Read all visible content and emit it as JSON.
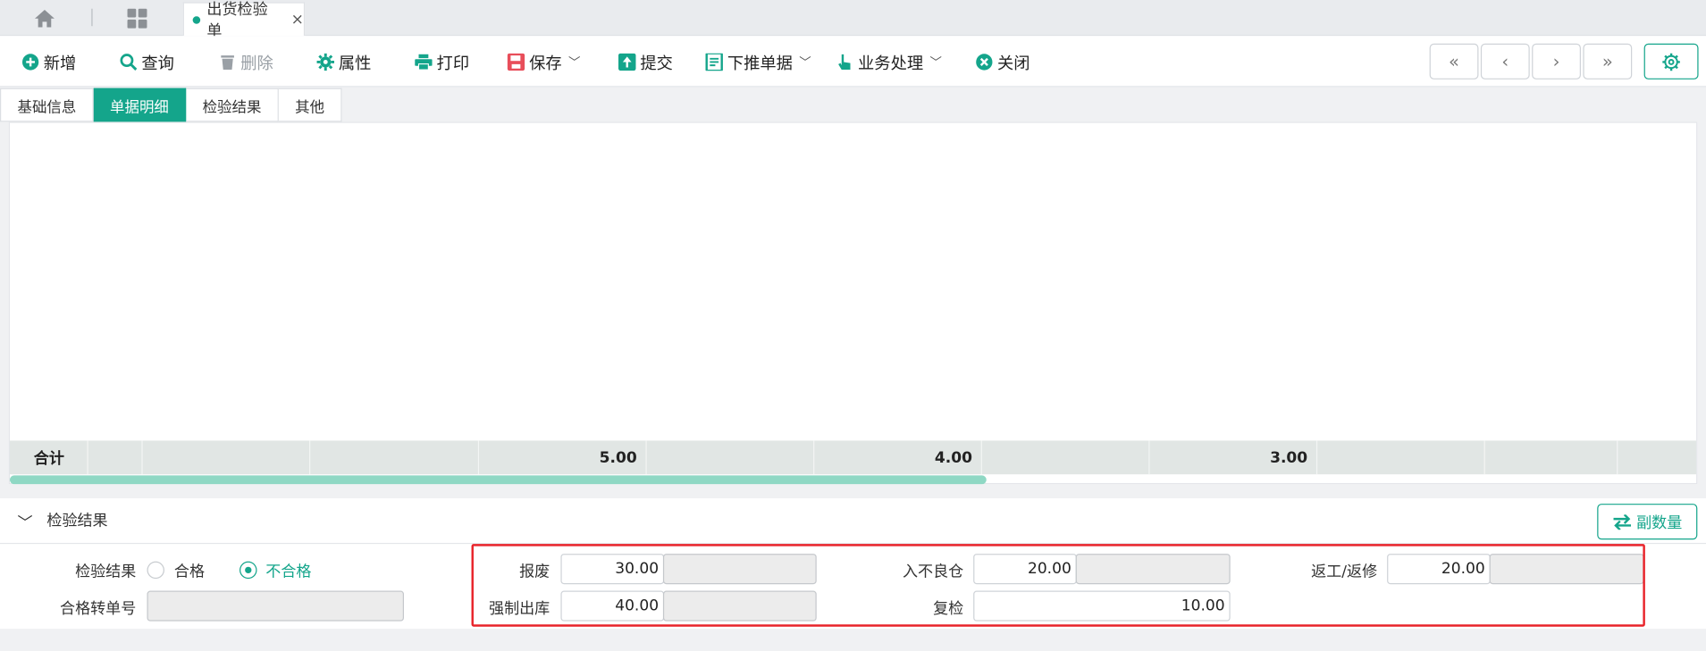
{
  "tabstrip": {
    "doc_tab_label": "出货检验单",
    "close_glyph": "×"
  },
  "toolbar": {
    "add": "新增",
    "query": "查询",
    "delete": "删除",
    "properties": "属性",
    "print": "打印",
    "save": "保存",
    "submit": "提交",
    "push_down": "下推单据",
    "business": "业务处理",
    "close": "关闭"
  },
  "nav": {
    "first": "«",
    "prev": "‹",
    "next": "›",
    "last": "»"
  },
  "subtabs": [
    "基础信息",
    "单据明细",
    "检验结果",
    "其他"
  ],
  "subtabs_active": 1,
  "grid": {
    "total_label": "合计",
    "totals": [
      "",
      "",
      "",
      "5.00",
      "",
      "4.00",
      "",
      "3.00",
      "",
      ""
    ]
  },
  "section": {
    "title": "检验结果",
    "side_button": "副数量"
  },
  "form": {
    "result_label": "检验结果",
    "pass_option": "合格",
    "fail_option": "不合格",
    "selected": "不合格",
    "transfer_label": "合格转单号",
    "transfer_value": "",
    "scrap_label": "报废",
    "scrap_value": "30.00",
    "bad_wh_label": "入不良仓",
    "bad_wh_value": "20.00",
    "rework_label": "返工/返修",
    "rework_value": "20.00",
    "forced_label": "强制出库",
    "forced_value": "40.00",
    "recheck_label": "复检",
    "recheck_value": "10.00"
  },
  "colors": {
    "accent": "#14a58b",
    "highlight_box": "#e8232a"
  }
}
